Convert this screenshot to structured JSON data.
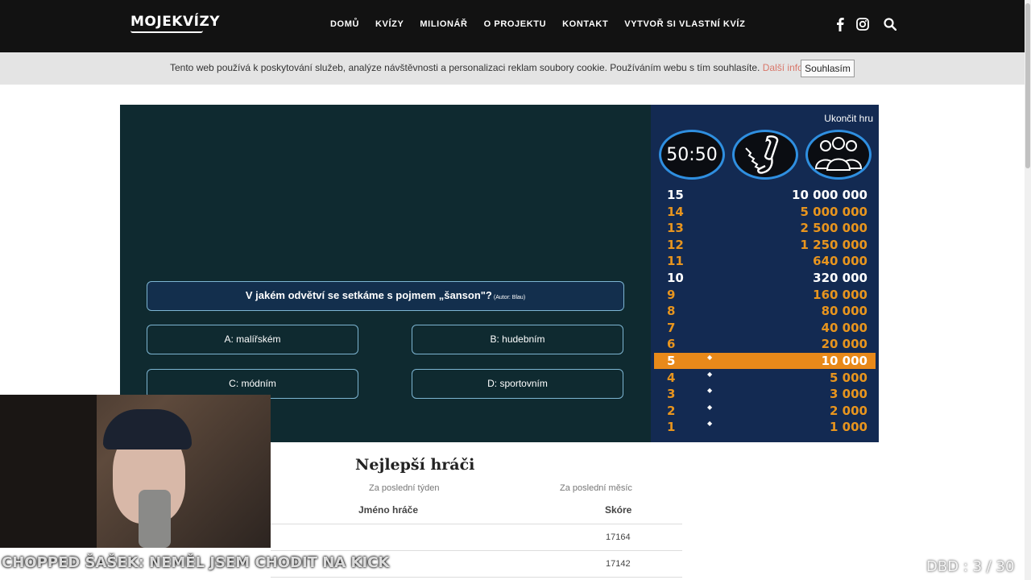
{
  "header": {
    "logo": "MOJEKVÍZY",
    "nav": [
      "DOMŮ",
      "KVÍZY",
      "MILIONÁŘ",
      "O PROJEKTU",
      "KONTAKT",
      "VYTVOŘ SI VLASTNÍ KVÍZ"
    ],
    "icons": [
      "facebook-icon",
      "instagram-icon",
      "search-icon"
    ]
  },
  "cookie": {
    "text": "Tento web používá k poskytování služeb, analýze návštěvnosti a personalizaci reklam soubory cookie. Používáním webu s tím souhlasíte.",
    "link": "Další informace",
    "after_link": ".",
    "button": "Souhlasím"
  },
  "game": {
    "question": "V jakém odvětví se setkáme s pojmem „šanson\"?",
    "author": "(Autor: Blau)",
    "answers": {
      "a": "A: malířském",
      "b": "B: hudebním",
      "c": "C: módním",
      "d": "D: sportovním"
    }
  },
  "ladder": {
    "end_game": "Ukončit hru",
    "fifty_fifty": "50:50",
    "rungs": [
      {
        "num": "15",
        "amount": "10 000 000",
        "style": "white",
        "dot": false
      },
      {
        "num": "14",
        "amount": "5 000 000",
        "style": "orange",
        "dot": false
      },
      {
        "num": "13",
        "amount": "2 500 000",
        "style": "orange",
        "dot": false
      },
      {
        "num": "12",
        "amount": "1 250 000",
        "style": "orange",
        "dot": false
      },
      {
        "num": "11",
        "amount": "640 000",
        "style": "orange",
        "dot": false
      },
      {
        "num": "10",
        "amount": "320 000",
        "style": "white",
        "dot": false
      },
      {
        "num": "9",
        "amount": "160 000",
        "style": "orange",
        "dot": false
      },
      {
        "num": "8",
        "amount": "80 000",
        "style": "orange",
        "dot": false
      },
      {
        "num": "7",
        "amount": "40 000",
        "style": "orange",
        "dot": false
      },
      {
        "num": "6",
        "amount": "20 000",
        "style": "orange",
        "dot": false
      },
      {
        "num": "5",
        "amount": "10 000",
        "style": "current",
        "dot": true
      },
      {
        "num": "4",
        "amount": "5 000",
        "style": "orange",
        "dot": true
      },
      {
        "num": "3",
        "amount": "3 000",
        "style": "orange",
        "dot": true
      },
      {
        "num": "2",
        "amount": "2 000",
        "style": "orange",
        "dot": true
      },
      {
        "num": "1",
        "amount": "1 000",
        "style": "orange",
        "dot": true
      }
    ],
    "dot_char": "◆"
  },
  "leaderboard": {
    "title": "Nejlepší hráči",
    "tab_week": "Za poslední týden",
    "tab_month": "Za poslední měsíc",
    "col_name": "Jméno hráče",
    "col_score": "Skóre",
    "rows": [
      {
        "score": "17164"
      },
      {
        "score": "17142"
      }
    ]
  },
  "overlay": {
    "caption": "CHOPPED ŠAŠEK: NEMĚL JSEM CHODIT NA KICK",
    "counter": "DBD : 3 / 30"
  },
  "colors": {
    "nav_bg": "#121212",
    "game_bg": "#0f2a30",
    "ladder_bg": "#132a52",
    "ladder_orange": "#e8951e",
    "current_rung": "#e8891a",
    "lifeline_ring": "#2f8fe0",
    "cookie_link": "#d9776a"
  }
}
